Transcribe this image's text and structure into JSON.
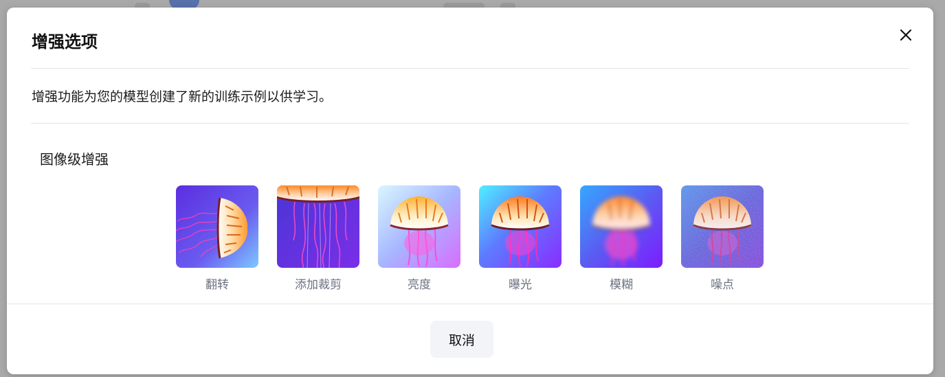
{
  "modal": {
    "title": "增强选项",
    "description": "增强功能为您的模型创建了新的训练示例以供学习。",
    "section_title": "图像级增强",
    "close_icon": "close-icon",
    "options": [
      {
        "label": "翻转",
        "effect": "flip"
      },
      {
        "label": "添加裁剪",
        "effect": "crop"
      },
      {
        "label": "亮度",
        "effect": "brightness"
      },
      {
        "label": "曝光",
        "effect": "exposure"
      },
      {
        "label": "模糊",
        "effect": "blur"
      },
      {
        "label": "噪点",
        "effect": "noise"
      }
    ],
    "cancel_label": "取消"
  },
  "colors": {
    "overlay": "#a9a9a9",
    "modal_bg": "#ffffff",
    "divider": "#e3e5e8",
    "option_label": "#6b7280",
    "cancel_bg": "#f2f4f7"
  }
}
